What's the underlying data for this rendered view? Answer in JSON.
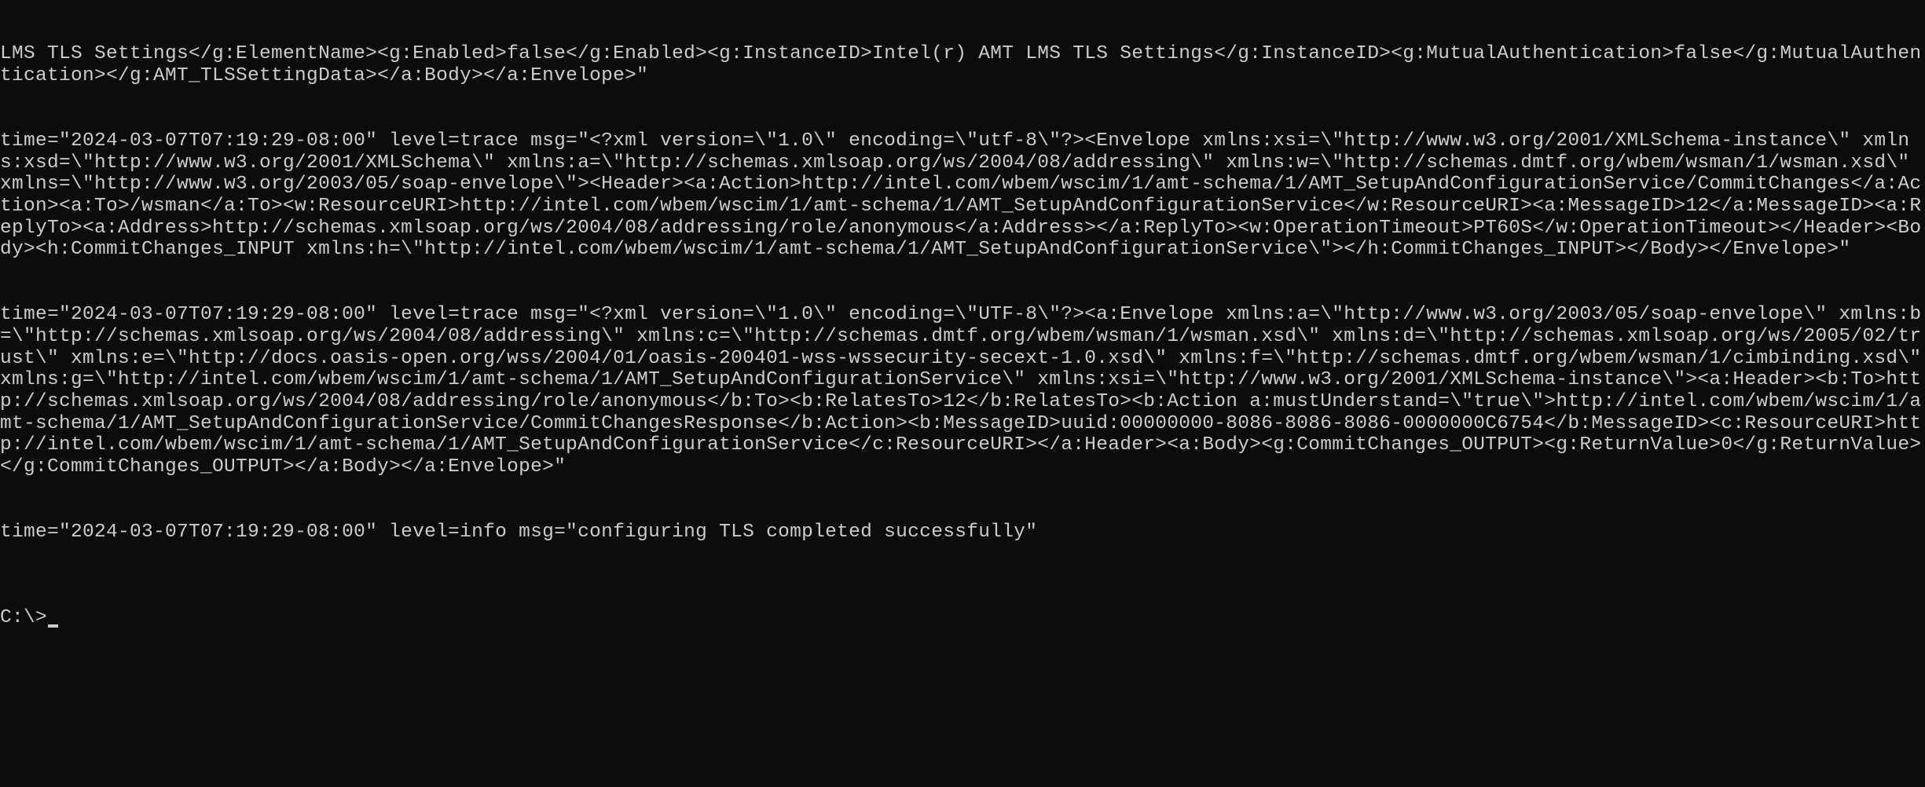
{
  "terminal": {
    "logLines": [
      "LMS TLS Settings</g:ElementName><g:Enabled>false</g:Enabled><g:InstanceID>Intel(r) AMT LMS TLS Settings</g:InstanceID><g:MutualAuthentication>false</g:MutualAuthentication></g:AMT_TLSSettingData></a:Body></a:Envelope>\"",
      "time=\"2024-03-07T07:19:29-08:00\" level=trace msg=\"<?xml version=\\\"1.0\\\" encoding=\\\"utf-8\\\"?><Envelope xmlns:xsi=\\\"http://www.w3.org/2001/XMLSchema-instance\\\" xmlns:xsd=\\\"http://www.w3.org/2001/XMLSchema\\\" xmlns:a=\\\"http://schemas.xmlsoap.org/ws/2004/08/addressing\\\" xmlns:w=\\\"http://schemas.dmtf.org/wbem/wsman/1/wsman.xsd\\\" xmlns=\\\"http://www.w3.org/2003/05/soap-envelope\\\"><Header><a:Action>http://intel.com/wbem/wscim/1/amt-schema/1/AMT_SetupAndConfigurationService/CommitChanges</a:Action><a:To>/wsman</a:To><w:ResourceURI>http://intel.com/wbem/wscim/1/amt-schema/1/AMT_SetupAndConfigurationService</w:ResourceURI><a:MessageID>12</a:MessageID><a:ReplyTo><a:Address>http://schemas.xmlsoap.org/ws/2004/08/addressing/role/anonymous</a:Address></a:ReplyTo><w:OperationTimeout>PT60S</w:OperationTimeout></Header><Body><h:CommitChanges_INPUT xmlns:h=\\\"http://intel.com/wbem/wscim/1/amt-schema/1/AMT_SetupAndConfigurationService\\\"></h:CommitChanges_INPUT></Body></Envelope>\"",
      "time=\"2024-03-07T07:19:29-08:00\" level=trace msg=\"<?xml version=\\\"1.0\\\" encoding=\\\"UTF-8\\\"?><a:Envelope xmlns:a=\\\"http://www.w3.org/2003/05/soap-envelope\\\" xmlns:b=\\\"http://schemas.xmlsoap.org/ws/2004/08/addressing\\\" xmlns:c=\\\"http://schemas.dmtf.org/wbem/wsman/1/wsman.xsd\\\" xmlns:d=\\\"http://schemas.xmlsoap.org/ws/2005/02/trust\\\" xmlns:e=\\\"http://docs.oasis-open.org/wss/2004/01/oasis-200401-wss-wssecurity-secext-1.0.xsd\\\" xmlns:f=\\\"http://schemas.dmtf.org/wbem/wsman/1/cimbinding.xsd\\\" xmlns:g=\\\"http://intel.com/wbem/wscim/1/amt-schema/1/AMT_SetupAndConfigurationService\\\" xmlns:xsi=\\\"http://www.w3.org/2001/XMLSchema-instance\\\"><a:Header><b:To>http://schemas.xmlsoap.org/ws/2004/08/addressing/role/anonymous</b:To><b:RelatesTo>12</b:RelatesTo><b:Action a:mustUnderstand=\\\"true\\\">http://intel.com/wbem/wscim/1/amt-schema/1/AMT_SetupAndConfigurationService/CommitChangesResponse</b:Action><b:MessageID>uuid:00000000-8086-8086-8086-0000000C6754</b:MessageID><c:ResourceURI>http://intel.com/wbem/wscim/1/amt-schema/1/AMT_SetupAndConfigurationService</c:ResourceURI></a:Header><a:Body><g:CommitChanges_OUTPUT><g:ReturnValue>0</g:ReturnValue></g:CommitChanges_OUTPUT></a:Body></a:Envelope>\"",
      "time=\"2024-03-07T07:19:29-08:00\" level=info msg=\"configuring TLS completed successfully\""
    ],
    "prompt": "C:\\>"
  }
}
